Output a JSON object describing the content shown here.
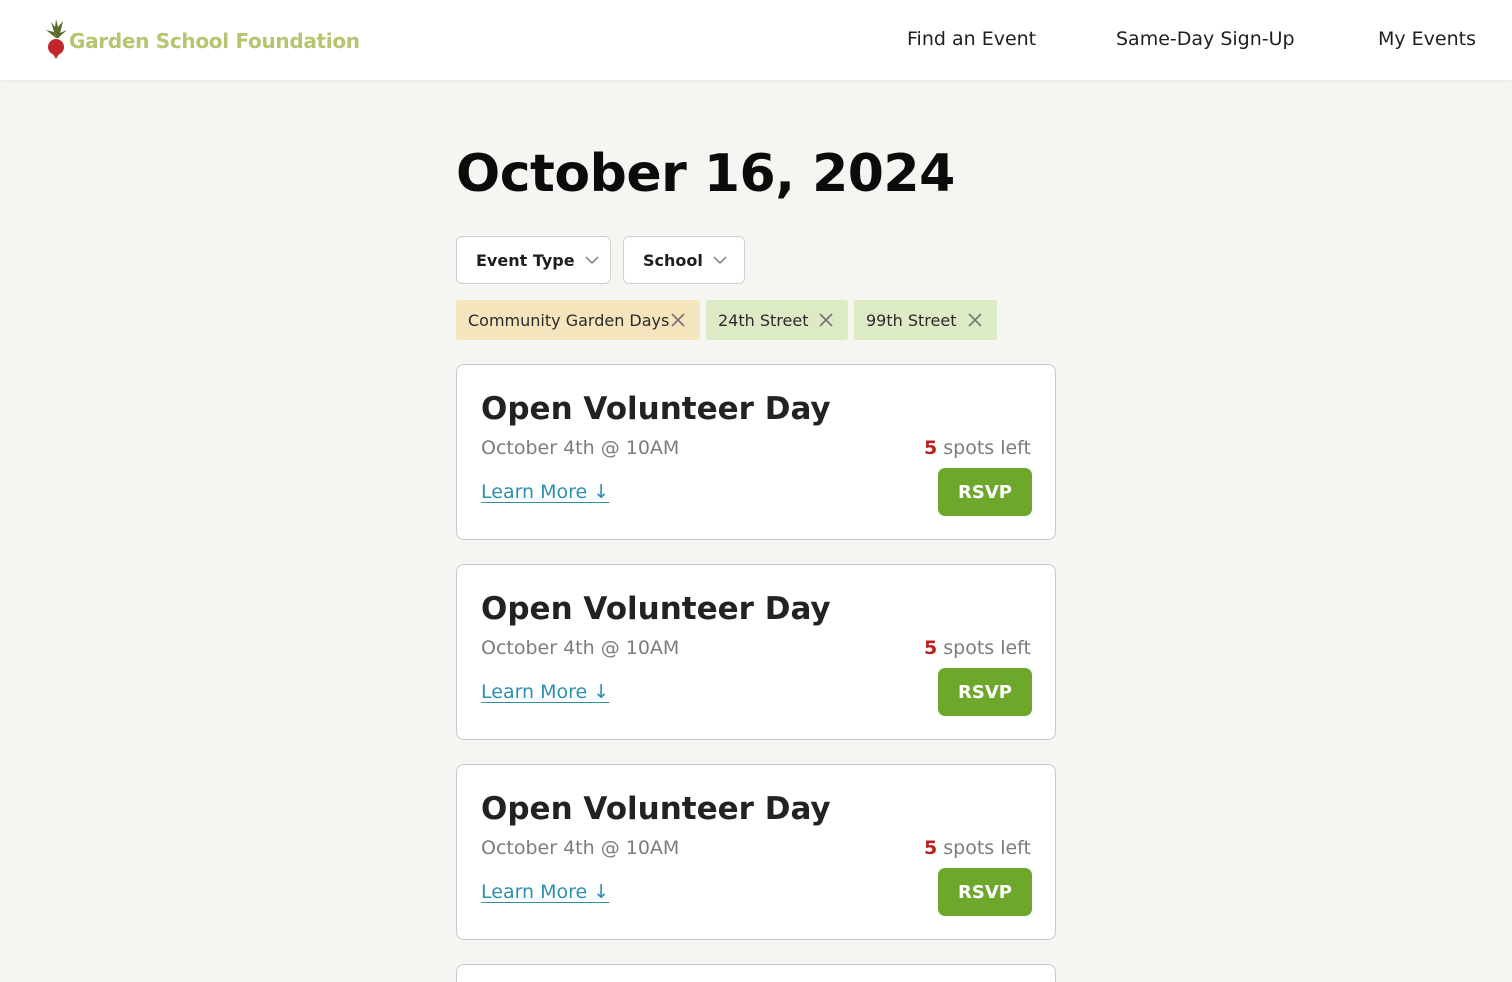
{
  "header": {
    "logo_text": "Garden School Foundation",
    "nav": {
      "find_event": "Find an Event",
      "same_day": "Same-Day Sign-Up",
      "my_events": "My Events"
    }
  },
  "main": {
    "date_title": "October 16, 2024",
    "filters": {
      "event_type_label": "Event Type",
      "school_label": "School"
    },
    "active_filters": [
      {
        "label": "Community Garden Days",
        "color": "#f5e5bd"
      },
      {
        "label": "24th Street",
        "color": "#dcebc6"
      },
      {
        "label": "99th Street",
        "color": "#dcebc6"
      }
    ],
    "events": [
      {
        "title": "Open Volunteer Day",
        "date": "October 4th @ 10AM",
        "spots_count": "5",
        "spots_suffix": " spots left",
        "learn_more": "Learn More ↓",
        "rsvp": "RSVP"
      },
      {
        "title": "Open Volunteer Day",
        "date": "October 4th @ 10AM",
        "spots_count": "5",
        "spots_suffix": " spots left",
        "learn_more": "Learn More ↓",
        "rsvp": "RSVP"
      },
      {
        "title": "Open Volunteer Day",
        "date": "October 4th @ 10AM",
        "spots_count": "5",
        "spots_suffix": " spots left",
        "learn_more": "Learn More ↓",
        "rsvp": "RSVP"
      }
    ]
  },
  "colors": {
    "brand_green": "#b6c56f",
    "rsvp_green": "#6ea82a",
    "spots_red": "#b8231f",
    "link_blue": "#2d8fb0",
    "page_bg": "#f5f5f1"
  },
  "icons": {
    "logo": "beet-logo-icon",
    "dropdown": "chevron-down-icon",
    "remove_filter": "close-icon"
  }
}
